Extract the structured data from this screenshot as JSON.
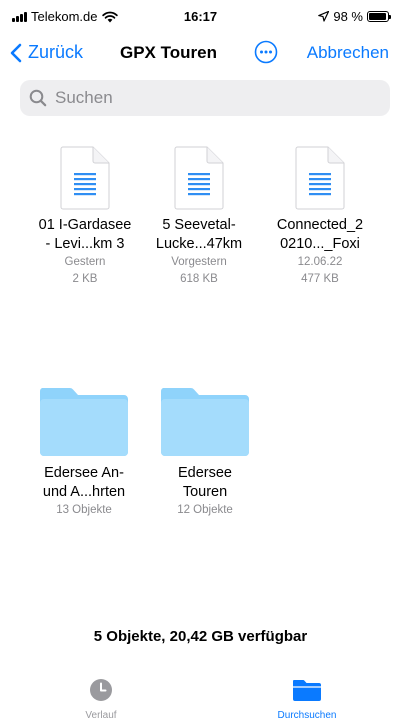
{
  "status_bar": {
    "carrier": "Telekom.de",
    "time": "16:17",
    "battery": "98 %"
  },
  "nav": {
    "back_label": "Zurück",
    "title": "GPX Touren",
    "cancel_label": "Abbrechen"
  },
  "search": {
    "placeholder": "Suchen"
  },
  "files": [
    {
      "name": "01 I-Gardasee\n- Levi...km 3",
      "date": "Gestern",
      "size": "2 KB"
    },
    {
      "name": "5 Seevetal-\nLucke...47km",
      "date": "Vorgestern",
      "size": "618 KB"
    },
    {
      "name": "Connected_2\n0210..._Foxi",
      "date": "12.06.22",
      "size": "477 KB"
    }
  ],
  "folders": [
    {
      "name": "Edersee An-\nund A...hrten",
      "count": "13 Objekte"
    },
    {
      "name": "Edersee\nTouren",
      "count": "12 Objekte"
    }
  ],
  "storage_info": "5 Objekte, 20,42 GB verfügbar",
  "tabs": [
    {
      "label": "Verlauf",
      "icon": "clock-icon",
      "active": false
    },
    {
      "label": "Durchsuchen",
      "icon": "folder-icon",
      "active": true
    }
  ],
  "colors": {
    "accent": "#0a7aff",
    "folder": "#8fd3fb",
    "doc_lines": "#2f8ef3",
    "secondary_text": "#8a8a8e"
  }
}
